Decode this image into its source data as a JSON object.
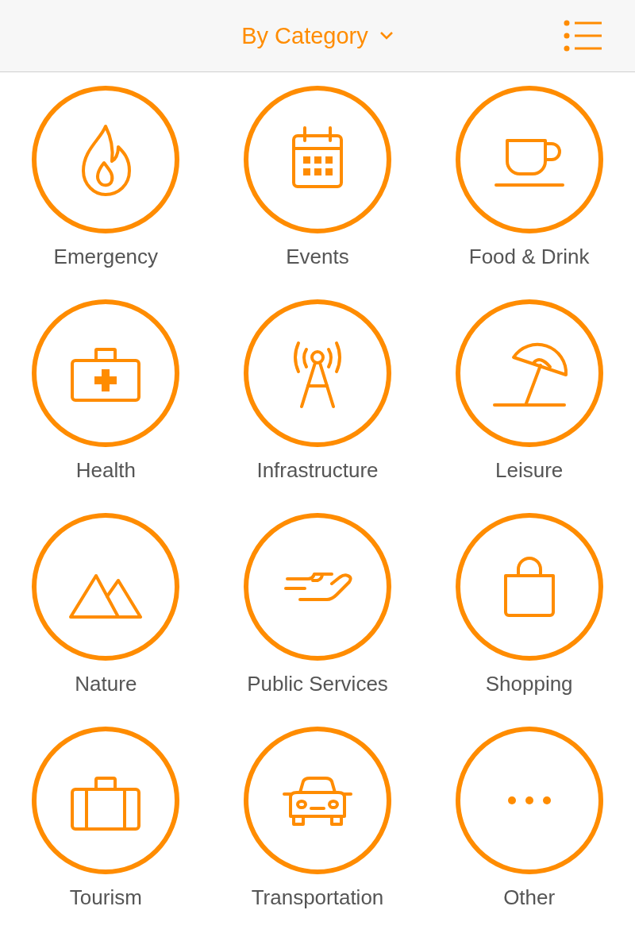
{
  "header": {
    "title": "By Category"
  },
  "categories": [
    {
      "label": "Emergency"
    },
    {
      "label": "Events"
    },
    {
      "label": "Food & Drink"
    },
    {
      "label": "Health"
    },
    {
      "label": "Infrastructure"
    },
    {
      "label": "Leisure"
    },
    {
      "label": "Nature"
    },
    {
      "label": "Public Services"
    },
    {
      "label": "Shopping"
    },
    {
      "label": "Tourism"
    },
    {
      "label": "Transportation"
    },
    {
      "label": "Other"
    }
  ]
}
